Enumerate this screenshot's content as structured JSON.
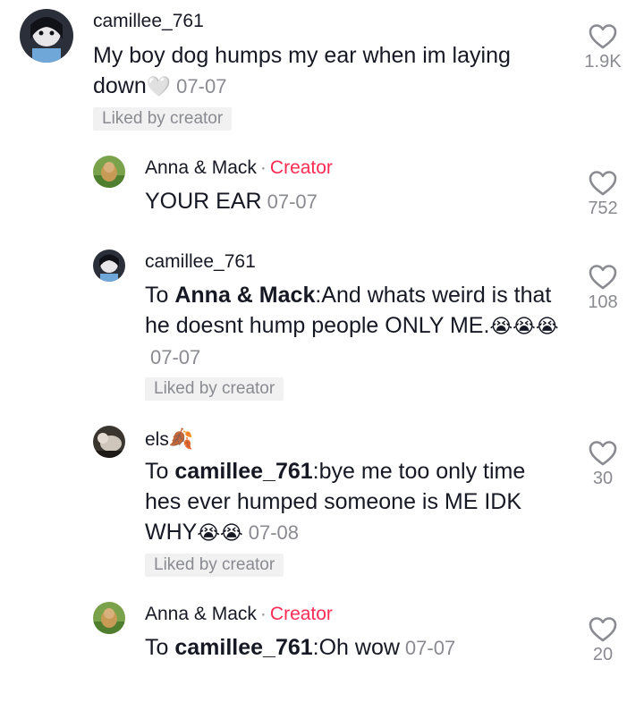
{
  "comments": [
    {
      "username": "camillee_761",
      "creator_tag": "",
      "reply_to": "",
      "text": "My boy dog humps my ear when im laying down",
      "emoji": "🤍",
      "date": "07-07",
      "liked_label": "Liked by creator",
      "likes": "1.9K"
    },
    {
      "username": "Anna & Mack",
      "separator": "·",
      "creator_tag": "Creator",
      "reply_to": "",
      "text": "YOUR EAR",
      "date": "07-07",
      "likes": "752"
    },
    {
      "username": "camillee_761",
      "reply_to_prefix": "To ",
      "reply_to": "Anna & Mack",
      "reply_sep": ":",
      "text": "And whats weird is that he doesnt hump people ONLY ME.",
      "emoji": "😭😭😭",
      "date": "07-07",
      "liked_label": "Liked by creator",
      "likes": "108"
    },
    {
      "username": "els",
      "username_emoji": "🍂",
      "reply_to_prefix": "To ",
      "reply_to": "camillee_761",
      "reply_sep": ":",
      "text": "bye me too only time hes ever humped someone is ME IDK WHY",
      "emoji": "😭😭",
      "date": "07-08",
      "liked_label": "Liked by creator",
      "likes": "30"
    },
    {
      "username": "Anna & Mack",
      "separator": "·",
      "creator_tag": "Creator",
      "reply_to_prefix": "To ",
      "reply_to": "camillee_761",
      "reply_sep": ":",
      "text": "Oh wow",
      "date": "07-07",
      "likes": "20"
    }
  ],
  "icons": {
    "like": "heart-outline-icon"
  },
  "colors": {
    "creator": "#fe2c55",
    "meta": "#8a8b91",
    "liked_bg": "#f1f1f2"
  }
}
